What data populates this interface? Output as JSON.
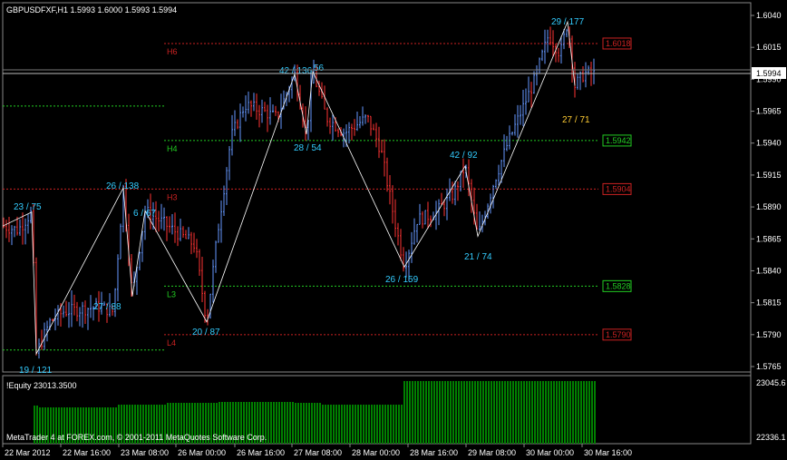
{
  "header": {
    "symbol_info": "GBPUSDFXF,H1  1.5993 1.6000 1.5993 1.5994"
  },
  "price_axis": {
    "ticks": [
      "1.6040",
      "1.6015",
      "1.5990",
      "1.5965",
      "1.5940",
      "1.5915",
      "1.5890",
      "1.5865",
      "1.5840",
      "1.5815",
      "1.5790",
      "1.5765"
    ],
    "current_price": "1.5994"
  },
  "time_axis": {
    "labels": [
      "22 Mar 2012",
      "22 Mar 16:00",
      "23 Mar 08:00",
      "26 Mar 00:00",
      "26 Mar 16:00",
      "27 Mar 08:00",
      "28 Mar 00:00",
      "28 Mar 16:00",
      "29 Mar 08:00",
      "30 Mar 00:00",
      "30 Mar 16:00"
    ]
  },
  "levels": [
    {
      "name": "H6",
      "value": "1.6018",
      "color": "#cc2222"
    },
    {
      "name": "H4",
      "value": "1.5942",
      "color": "#22cc22"
    },
    {
      "name": "H3",
      "value": "1.5904",
      "color": "#cc2222"
    },
    {
      "name": "L3",
      "value": "1.5828",
      "color": "#22cc22"
    },
    {
      "name": "L4",
      "value": "1.5790",
      "color": "#cc2222"
    }
  ],
  "swing_labels": [
    "23 / 75",
    "26 / 138",
    "6 / 67",
    "27 / 88",
    "20 / 87",
    "42 / 136",
    "56",
    "28 / 54",
    "26 / 159",
    "42 / 92",
    "21 / 74",
    "29 / 177",
    "27 / 71",
    "19 / 121"
  ],
  "indicator": {
    "title": "!Equity 23013.3500",
    "axis_ticks": [
      "23045.6",
      "22336.1"
    ],
    "bar_color": "#008000"
  },
  "footer": {
    "copyright": "MetaTrader 4 at FOREX.com, © 2001-2011 MetaQuotes Software Corp."
  },
  "colors": {
    "background": "#000000",
    "bull_bar": "#6699ff",
    "bear_bar": "#ff3333",
    "zigzag": "#ffffff",
    "label_cyan": "#33ccff",
    "label_yellow": "#ffcc33",
    "grid": "#ffffff"
  }
}
